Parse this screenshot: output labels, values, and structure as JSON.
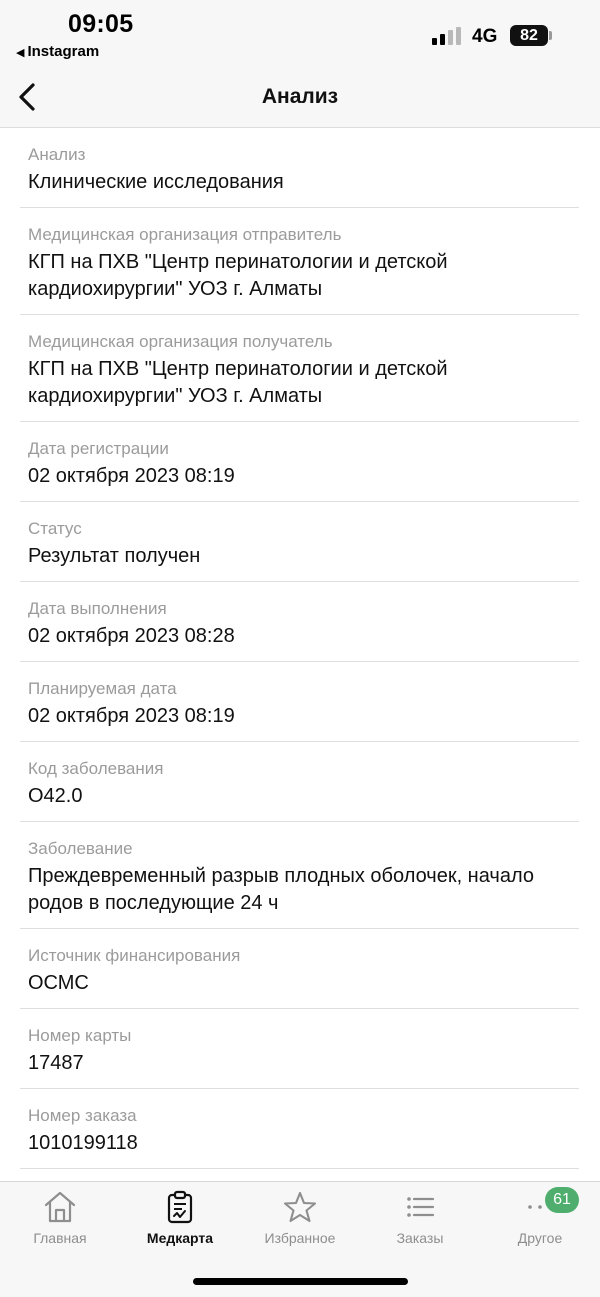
{
  "status_bar": {
    "time": "09:05",
    "back_app": "Instagram",
    "network": "4G",
    "battery": "82"
  },
  "header": {
    "title": "Анализ",
    "back_icon": "chevron-left-icon"
  },
  "fields": [
    {
      "label": "Анализ",
      "value": "Клинические исследования"
    },
    {
      "label": "Медицинская организация отправитель",
      "value": "КГП на ПХВ \"Центр перинатологии и детской кардиохирургии\" УОЗ г. Алматы"
    },
    {
      "label": "Медицинская организация получатель",
      "value": "КГП на ПХВ \"Центр перинатологии и детской кардиохирургии\" УОЗ г. Алматы"
    },
    {
      "label": "Дата регистрации",
      "value": "02 октября 2023 08:19"
    },
    {
      "label": "Статус",
      "value": "Результат получен"
    },
    {
      "label": "Дата выполнения",
      "value": "02 октября 2023 08:28"
    },
    {
      "label": "Планируемая дата",
      "value": "02 октября 2023 08:19"
    },
    {
      "label": "Код заболевания",
      "value": "O42.0"
    },
    {
      "label": "Заболевание",
      "value": "Преждевременный разрыв плодных оболочек, начало родов в последующие 24 ч"
    },
    {
      "label": "Источник финансирования",
      "value": "ОСМС"
    },
    {
      "label": "Номер карты",
      "value": "17487"
    },
    {
      "label": "Номер заказа",
      "value": "1010199118"
    }
  ],
  "tabs": [
    {
      "label": "Главная",
      "icon": "home-icon"
    },
    {
      "label": "Медкарта",
      "icon": "medical-record-icon"
    },
    {
      "label": "Избранное",
      "icon": "star-icon"
    },
    {
      "label": "Заказы",
      "icon": "list-icon"
    },
    {
      "label": "Другое",
      "icon": "more-icon",
      "badge": "61"
    }
  ],
  "colors": {
    "badge": "#4fae6e",
    "label_gray": "#9b9b9b",
    "bar_bg": "#f7f7f7"
  }
}
